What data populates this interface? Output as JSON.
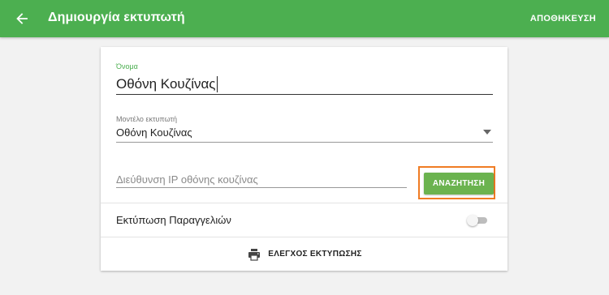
{
  "appbar": {
    "back_icon": "arrow-back-icon",
    "title": "Δημιουργία εκτυπωτή",
    "save_label": "ΑΠΟΘΗΚΕΥΣΗ",
    "color": "#4caf50"
  },
  "form": {
    "name": {
      "label": "Όνομα",
      "value": "Οθόνη Κουζίνας"
    },
    "model": {
      "label": "Μοντέλο εκτυπωτή",
      "selected": "Οθόνη Κουζίνας",
      "icon": "dropdown-arrow-icon"
    },
    "ip": {
      "placeholder": "Διεύθυνση IP οθόνης κουζίνας",
      "value": ""
    },
    "search_label": "ΑΝΑΖΗΤΗΣΗ",
    "print_orders": {
      "label": "Εκτύπωση Παραγγελιών",
      "enabled": false
    },
    "test_print": {
      "icon": "printer-icon",
      "label": "ΕΛΕΓΧΟΣ ΕΚΤΥΠΩΣΗΣ"
    }
  },
  "colors": {
    "accent": "#4caf50",
    "button": "#6bb34f",
    "highlight": "#f07c24"
  }
}
